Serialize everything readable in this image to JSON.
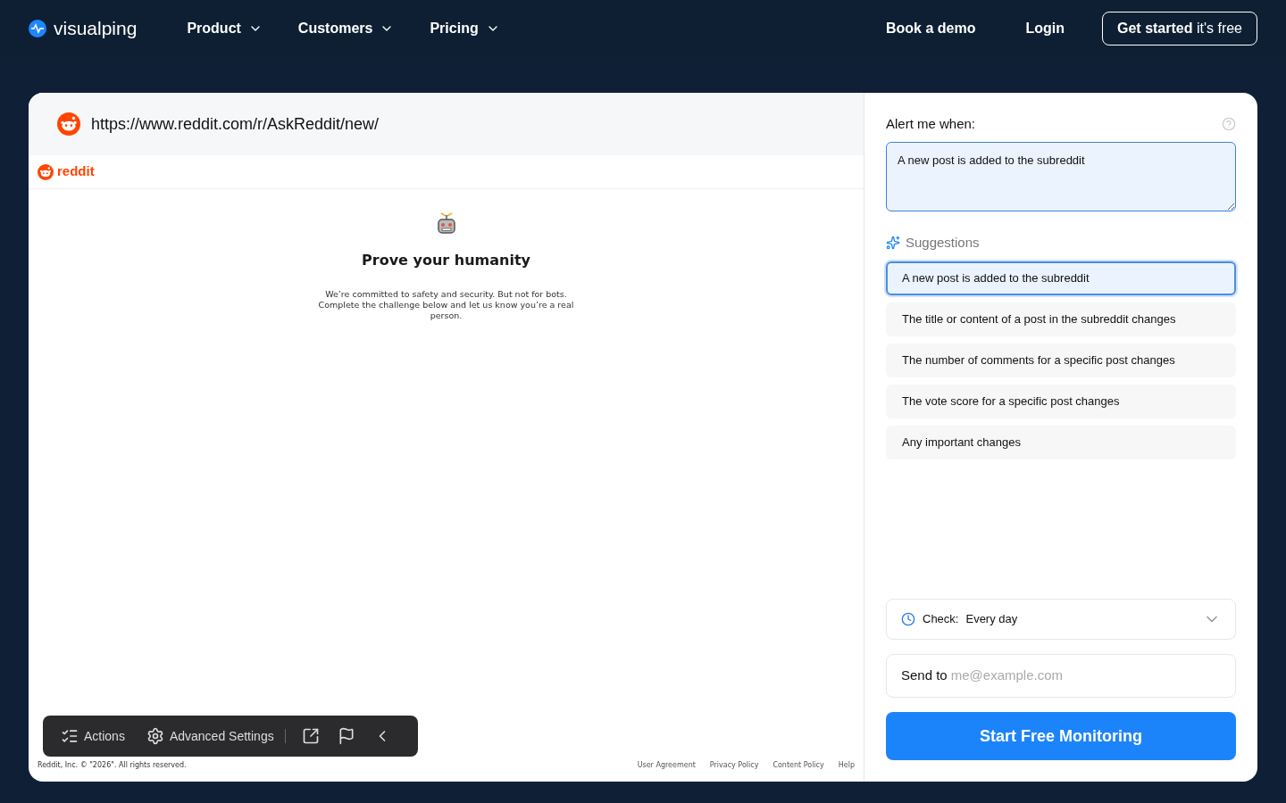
{
  "nav": {
    "brand": "visualping",
    "menus": [
      {
        "label": "Product"
      },
      {
        "label": "Customers"
      },
      {
        "label": "Pricing"
      }
    ],
    "links": [
      "Book a demo",
      "Login"
    ],
    "cta": "**Get started** it's free"
  },
  "preview": {
    "url": "https://www.reddit.com/r/AskReddit/new/",
    "site_logo": "reddit",
    "title": "Prove your humanity",
    "message": "We’re committed to safety and security. But not for bots. Complete the challenge below and let us know you’re a real person.",
    "copyright": "Reddit, Inc. © \"2026\". All rights reserved.",
    "footer_links": [
      "User Agreement",
      "Privacy Policy",
      "Content Policy",
      "Help"
    ]
  },
  "toolbar": {
    "items": [
      {
        "kind": "actions",
        "label": "Actions"
      },
      {
        "kind": "settings",
        "label": "Advanced Settings"
      },
      {
        "kind": "open"
      },
      {
        "kind": "flag"
      },
      {
        "kind": "collapse"
      }
    ]
  },
  "form": {
    "alert_label": "Alert me when:",
    "alert_value": "A new post is added to the subreddit",
    "suggestions_label": "Suggestions",
    "suggestions": [
      {
        "label": "A new post is added to the subreddit",
        "selected": true
      },
      {
        "label": "The title or content of a post in the subreddit changes",
        "selected": false
      },
      {
        "label": "The number of comments for a specific post changes",
        "selected": false
      },
      {
        "label": "The vote score for a specific post changes",
        "selected": false
      },
      {
        "label": "Any important changes",
        "selected": false
      }
    ],
    "check_label": "Check:",
    "check_value": "Every day",
    "send_label": "Send to",
    "send_placeholder": "me@example.com",
    "submit": "Start Free Monitoring"
  }
}
